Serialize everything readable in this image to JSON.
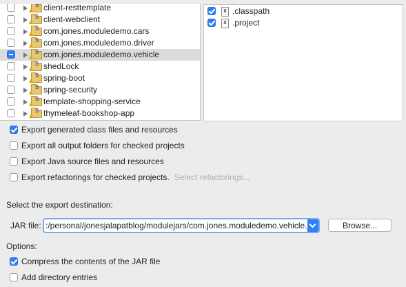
{
  "projects": [
    {
      "label": "client-resttemplate",
      "state": "unchecked"
    },
    {
      "label": "client-webclient",
      "state": "unchecked"
    },
    {
      "label": "com.jones.moduledemo.cars",
      "state": "unchecked"
    },
    {
      "label": "com.jones.moduledemo.driver",
      "state": "unchecked"
    },
    {
      "label": "com.jones.moduledemo.vehicle",
      "state": "mixed",
      "selected": true
    },
    {
      "label": "shedLock",
      "state": "unchecked"
    },
    {
      "label": "spring-boot",
      "state": "unchecked"
    },
    {
      "label": "spring-security",
      "state": "unchecked"
    },
    {
      "label": "template-shopping-service",
      "state": "unchecked"
    },
    {
      "label": "thymeleaf-bookshop-app",
      "state": "unchecked"
    }
  ],
  "files": [
    {
      "label": ".classpath",
      "checked": true,
      "icon_glyph": "X"
    },
    {
      "label": ".project",
      "checked": true,
      "icon_glyph": "X"
    }
  ],
  "export_options": {
    "generated": {
      "label": "Export generated class files and resources",
      "checked": true
    },
    "output_folders": {
      "label": "Export all output folders for checked projects",
      "checked": false
    },
    "java_source": {
      "label": "Export Java source files and resources",
      "checked": false
    },
    "refactorings": {
      "label": "Export refactorings for checked projects.",
      "checked": false,
      "link": "Select refactorings..."
    }
  },
  "destination": {
    "heading": "Select the export destination:",
    "jar_label": "JAR file:",
    "jar_value": ":/personal/jonesjalapatblog/modulejars/com.jones.moduledemo.vehicle.ja",
    "browse_label": "Browse..."
  },
  "options": {
    "heading": "Options:",
    "compress": {
      "label": "Compress the contents of the JAR file",
      "checked": true
    },
    "directory": {
      "label": "Add directory entries",
      "checked": false
    }
  },
  "colors": {
    "accent": "#2f7ff6",
    "background": "#ececec"
  }
}
